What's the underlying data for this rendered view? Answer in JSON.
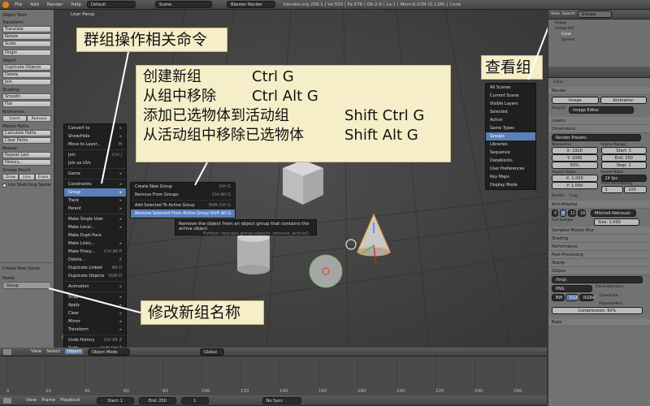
{
  "topbar": {
    "menus": [
      "File",
      "Add",
      "Render",
      "Help"
    ],
    "layout": "Default",
    "scene": "Scene",
    "engine": "Blender Render",
    "stats": "blender.org 258.1 | Ve:550 | Fa:578 | Ob:2-6 | La:1 | Mem:8.02M (0.11M) | Cone"
  },
  "left": {
    "title": "Object Tools",
    "transform": "Transform:",
    "translate": "Translate",
    "rotate": "Rotate",
    "scale": "Scale",
    "origin": "Origin",
    "object": "Object:",
    "duplicate": "Duplicate Objects",
    "delete": "Delete",
    "join": "Join",
    "shading": "Shading:",
    "smooth": "Smooth",
    "flat": "Flat",
    "keyframes": "Keyframes:",
    "insert": "Insert",
    "remove": "Remove",
    "motion": "Motion Paths:",
    "calc": "Calculate Paths",
    "clear": "Clear Paths",
    "repeat": "Repeat:",
    "repeat_last": "Repeat Last",
    "history": "History...",
    "grease": "Grease Pencil:",
    "draw": "Draw",
    "line": "Line",
    "erase": "Erase",
    "sketch": "Use Sketching Sessio",
    "cng": "Create New Group",
    "name_label": "Name",
    "name_value": "Group"
  },
  "view": {
    "label": "User Persp"
  },
  "objmenu": [
    {
      "l": "Convert to",
      "s": "▸"
    },
    {
      "l": "Show/Hide",
      "s": "▸"
    },
    {
      "l": "Move to Layer...",
      "s": "M"
    },
    {
      "sep": true
    },
    {
      "l": "Join",
      "s": "Ctrl J"
    },
    {
      "l": "Join as UVs",
      "s": ""
    },
    {
      "sep": true
    },
    {
      "l": "Game",
      "s": "▸"
    },
    {
      "sep": true
    },
    {
      "l": "Constraints",
      "s": "▸"
    },
    {
      "l": "Group",
      "s": "▸",
      "sel": true
    },
    {
      "l": "Track",
      "s": "▸"
    },
    {
      "l": "Parent",
      "s": "▸"
    },
    {
      "sep": true
    },
    {
      "l": "Make Single User",
      "s": "▸"
    },
    {
      "l": "Make Local...",
      "s": "▸"
    },
    {
      "l": "Make Dupli-Face",
      "s": ""
    },
    {
      "l": "Make Links...",
      "s": "▸"
    },
    {
      "l": "Make Proxy...",
      "s": "Ctrl Alt P"
    },
    {
      "l": "Delete...",
      "s": "X"
    },
    {
      "l": "Duplicate Linked",
      "s": "Alt D"
    },
    {
      "l": "Duplicate Objects",
      "s": "Shift D"
    },
    {
      "sep": true
    },
    {
      "l": "Animation",
      "s": "▸"
    },
    {
      "sep": true
    },
    {
      "l": "Snap",
      "s": "▸"
    },
    {
      "l": "Apply",
      "s": "▸"
    },
    {
      "l": "Clear",
      "s": "▸"
    },
    {
      "l": "Mirror",
      "s": "▸"
    },
    {
      "l": "Transform",
      "s": "▸"
    },
    {
      "sep": true
    },
    {
      "l": "Undo History",
      "s": "Ctrl Alt Z"
    },
    {
      "l": "Redo",
      "s": "Shift Ctrl Z"
    },
    {
      "l": "Undo",
      "s": "Ctrl Z"
    }
  ],
  "groupmenu": [
    {
      "l": "Create New Group",
      "s": "Ctrl G"
    },
    {
      "l": "Remove From Groups",
      "s": "Ctrl Alt G"
    },
    {
      "sep": true
    },
    {
      "l": "Add Selected To Active Group",
      "s": "Shift Ctrl G"
    },
    {
      "l": "Remove Selected From Active Group",
      "s": "Shift Alt G",
      "sel": true
    }
  ],
  "tooltip": {
    "line1": "Remove the object from an object group that contains the active object",
    "line2": "Python: bpy.ops.group.objects_remove_active()"
  },
  "outlinermenu": [
    "All Scenes",
    "Current Scene",
    "Visible Layers",
    "Selected",
    "Active",
    "Same Types",
    "Groups",
    "Libraries",
    "Sequence",
    "Datablocks",
    "User Preferences",
    "Key Maps",
    "Display Mode"
  ],
  "callouts": {
    "group_ops": "群组操作相关命令",
    "view_groups": "查看组",
    "rename": "修改新组名称",
    "cmd1": "创建新组",
    "key1": "Ctrl G",
    "cmd2": "从组中移除",
    "key2": "Ctrl Alt G",
    "cmd3": "添加已选物体到活动组",
    "key3": "Shift Ctrl G",
    "cmd4": "从活动组中移除已选物体",
    "key4": "Shift Alt G"
  },
  "right": {
    "view": "View",
    "search": "Search",
    "display": "Groups",
    "tree": [
      "Group",
      "Group.001",
      "Cone",
      "Sphere"
    ],
    "cone": "Cone",
    "render": "Render",
    "image": "Image",
    "animation": "Animation",
    "display_label": "Display:",
    "display_val": "Image Editor",
    "layers": "Layers",
    "dimensions": "Dimensions",
    "preset": "Render Presets",
    "resolution": "Resolution:",
    "rx": "X: 1920",
    "ry": "Y: 1080",
    "pct": "50%",
    "frange": "Frame Range:",
    "fs": "Start: 1",
    "fe": "End: 250",
    "fst": "Step: 1",
    "aspect": "Aspect Ratio:",
    "ax": "X: 1.000",
    "ay": "Y: 1.000",
    "frate": "Frame Rate:",
    "fps": "24 fps",
    "remap": "Time Remapping:",
    "rold": "1",
    "rnew": "100",
    "border": "Border",
    "crop": "Crop",
    "aa": "Anti-Aliasing",
    "aa5": "5",
    "aa8": "8",
    "aa11": "11",
    "aa16": "16",
    "filter": "Mitchell-Netravali",
    "full": "Full Sample",
    "size": "Size: 1.000",
    "smb": "Sampled Motion Blur",
    "shading": "Shading",
    "perf": "Performance",
    "post": "Post Processing",
    "stamp": "Stamp",
    "output": "Output",
    "path": "/tmp\\",
    "png": "PNG",
    "fext": "File Extensions",
    "bw": "BW",
    "rgb": "RGB",
    "rgba": "RGBA",
    "overwrite": "Overwrite",
    "place": "Placeholders",
    "comp": "Compression: 90%",
    "bake": "Bake"
  },
  "viewhdr": {
    "view": "View",
    "select": "Select",
    "object": "Object",
    "mode": "Object Mode",
    "global": "Global"
  },
  "timeline": {
    "ticks": [
      "0",
      "20",
      "40",
      "60",
      "80",
      "100",
      "120",
      "140",
      "160",
      "180",
      "200",
      "220",
      "240",
      "260"
    ],
    "view": "View",
    "frame": "Frame",
    "playback": "Playback",
    "start": "Start: 1",
    "end": "End: 250",
    "cur": "1",
    "sync": "No Sync"
  }
}
